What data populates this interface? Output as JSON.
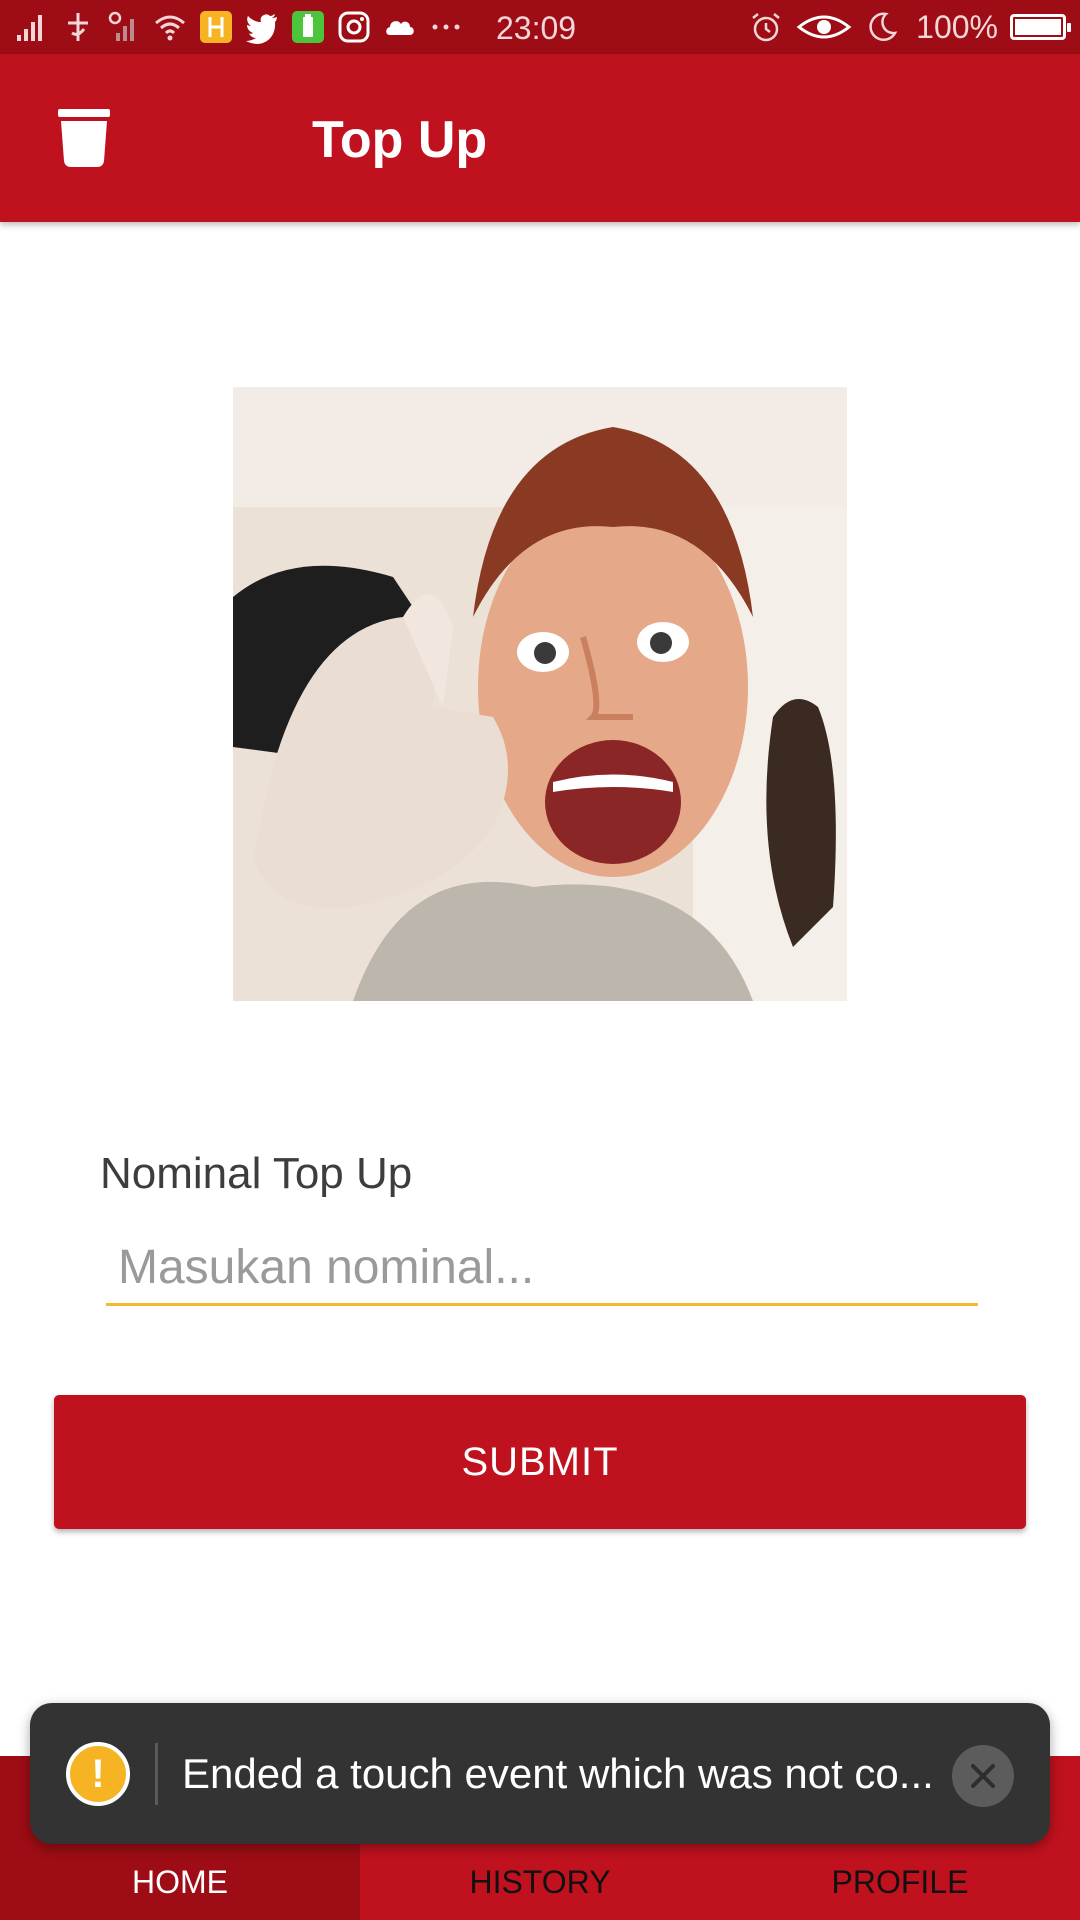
{
  "status_bar": {
    "time": "23:09",
    "battery_text": "100%",
    "battery_level": 1.0,
    "left_icons": [
      "signal-icon",
      "data-icon",
      "signal-weak-icon",
      "wifi-icon",
      "app-icon",
      "twitter-icon",
      "battery-app-icon",
      "instagram-icon",
      "cloud-icon",
      "more-icon"
    ],
    "right_icons": [
      "alarm-icon",
      "eye-icon",
      "moon-icon",
      "battery-icon"
    ]
  },
  "app_bar": {
    "title": "Top Up",
    "icon": "bucket-icon"
  },
  "form": {
    "label": "Nominal Top Up",
    "input_value": "",
    "input_placeholder": "Masukan nominal...",
    "submit_label": "SUBMIT"
  },
  "bottom_nav": {
    "items": [
      {
        "label": "HOME",
        "active": true
      },
      {
        "label": "HISTORY",
        "active": false
      },
      {
        "label": "PROFILE",
        "active": false
      }
    ]
  },
  "toast": {
    "icon": "warning-icon",
    "message": "Ended a touch event which was not co...",
    "close_icon": "close-icon"
  },
  "colors": {
    "primary": "#c0121e",
    "primary_dark": "#9e0d15",
    "accent": "#f5b82e",
    "toast_bg": "#333333"
  }
}
